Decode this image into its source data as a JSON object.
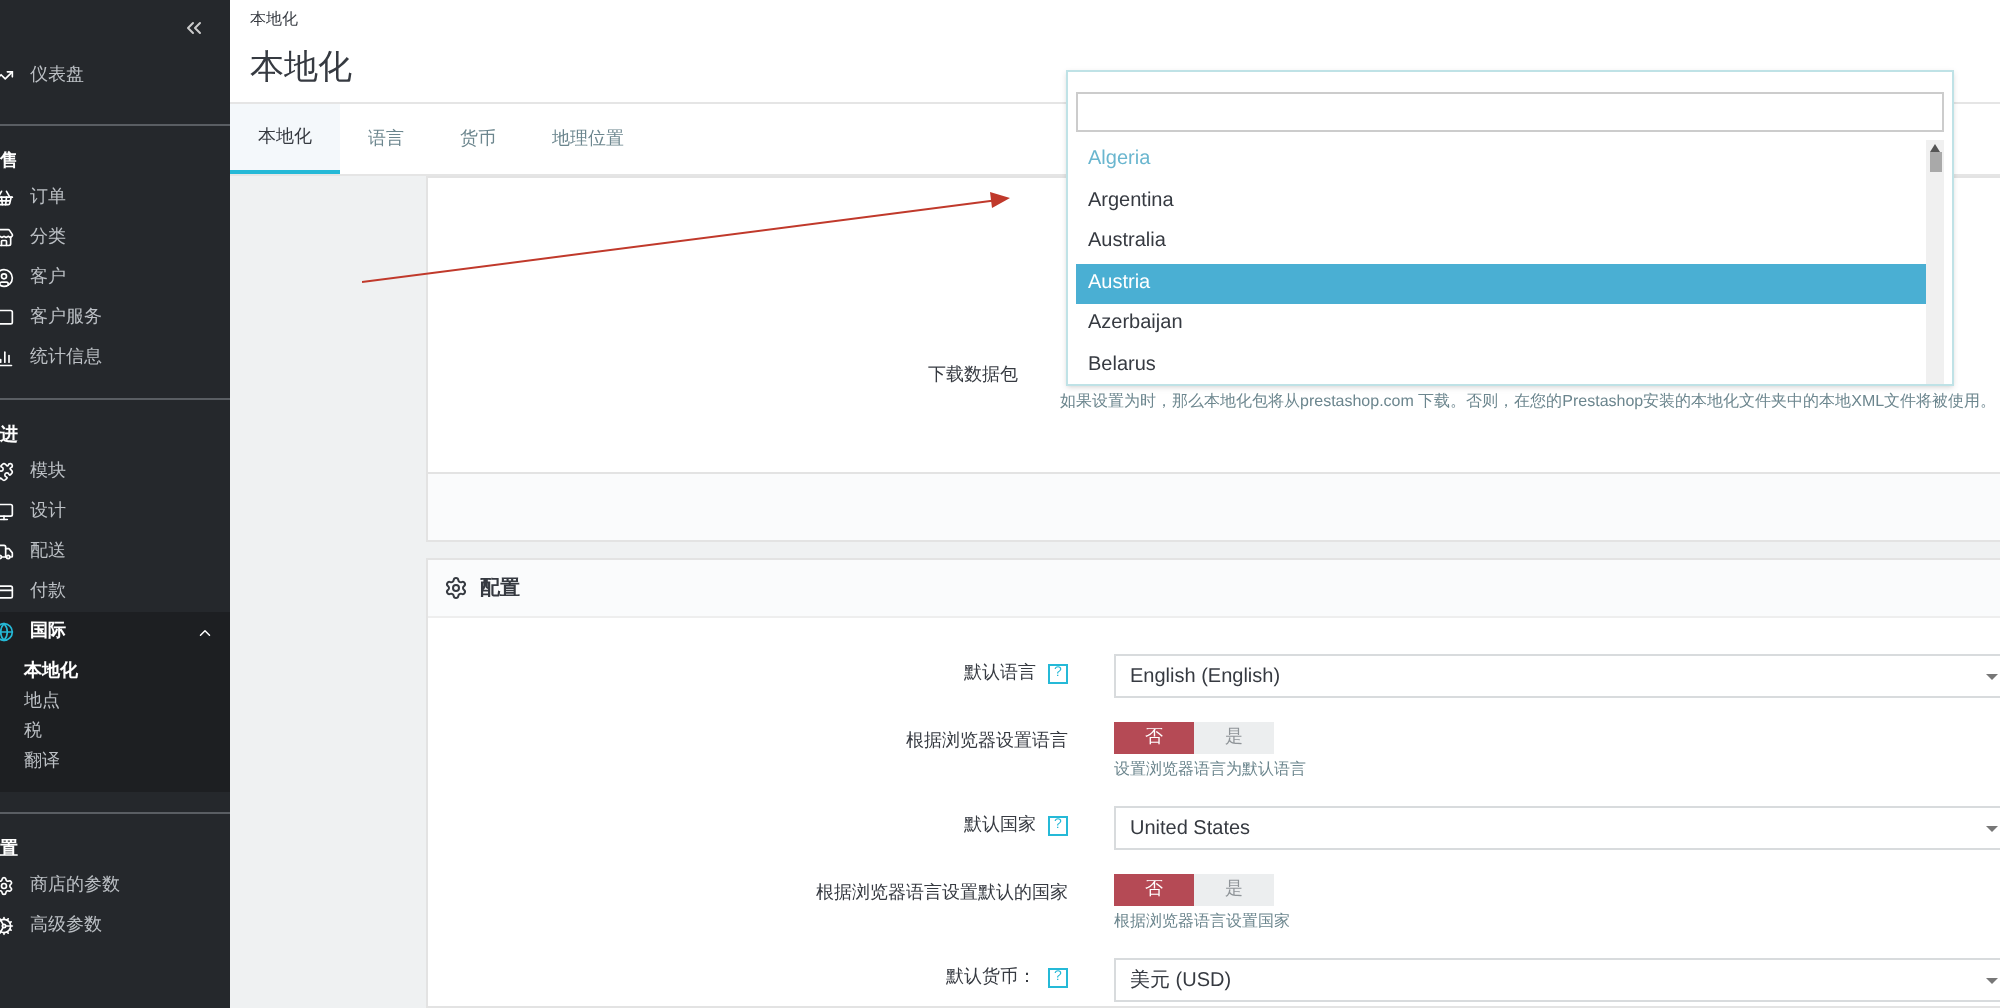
{
  "sidebar": {
    "sections": [
      {
        "items": [
          {
            "label": "仪表盘",
            "selected": false
          }
        ]
      },
      {
        "title": "售",
        "items": [
          {
            "label": "订单",
            "selected": false
          },
          {
            "label": "分类",
            "selected": false
          },
          {
            "label": "客户",
            "selected": false
          },
          {
            "label": "客户服务",
            "selected": false
          },
          {
            "label": "统计信息",
            "selected": false
          }
        ]
      },
      {
        "title": "进",
        "items": [
          {
            "label": "模块",
            "selected": false
          },
          {
            "label": "设计",
            "selected": false
          },
          {
            "label": "配送",
            "selected": false
          },
          {
            "label": "付款",
            "selected": false
          },
          {
            "label": "国际",
            "selected": true,
            "expanded": true,
            "children": [
              {
                "label": "本地化",
                "selected": true
              },
              {
                "label": "地点",
                "selected": false
              },
              {
                "label": "税",
                "selected": false
              },
              {
                "label": "翻译",
                "selected": false
              }
            ]
          }
        ]
      },
      {
        "title": "置",
        "items": [
          {
            "label": "商店的参数",
            "selected": false
          },
          {
            "label": "高级参数",
            "selected": false
          }
        ]
      }
    ]
  },
  "header": {
    "breadcrumb": "本地化",
    "title": "本地化"
  },
  "tabs": [
    {
      "label": "本地化",
      "selected": true
    },
    {
      "label": "语言",
      "selected": false
    },
    {
      "label": "货币",
      "selected": false
    },
    {
      "label": "地理位置",
      "selected": false
    }
  ],
  "import_panel": {
    "label": "下载数据包",
    "hint": "如果设置为时，那么本地化包将从prestashop.com 下载。否则，在您的Prestashop安装的本地化文件夹中的本地XML文件将被使用。",
    "dropdown": {
      "options": [
        {
          "label": "Algeria",
          "selected": false,
          "dimmed": true
        },
        {
          "label": "Argentina",
          "selected": false,
          "dimmed": false
        },
        {
          "label": "Australia",
          "selected": false,
          "dimmed": false
        },
        {
          "label": "Austria",
          "selected": true,
          "dimmed": false
        },
        {
          "label": "Azerbaijan",
          "selected": false,
          "dimmed": false
        },
        {
          "label": "Belarus",
          "selected": false,
          "dimmed": false
        }
      ]
    }
  },
  "config_panel": {
    "title": "配置",
    "rows": [
      {
        "kind": "select",
        "label": "默认语言",
        "help": "?",
        "value": "English (English)"
      },
      {
        "kind": "toggle",
        "label": "根据浏览器设置语言",
        "options": [
          {
            "label": "否",
            "selected": true
          },
          {
            "label": "是",
            "selected": false
          }
        ],
        "hint": "设置浏览器语言为默认语言"
      },
      {
        "kind": "select",
        "label": "默认国家",
        "help": "?",
        "value": "United States"
      },
      {
        "kind": "toggle",
        "label": "根据浏览器语言设置默认的国家",
        "options": [
          {
            "label": "否",
            "selected": true
          },
          {
            "label": "是",
            "selected": false
          }
        ],
        "hint": "根据浏览器语言设置国家"
      },
      {
        "kind": "select",
        "label": "默认货币：",
        "help": "?",
        "value": "美元 (USD)"
      }
    ]
  }
}
